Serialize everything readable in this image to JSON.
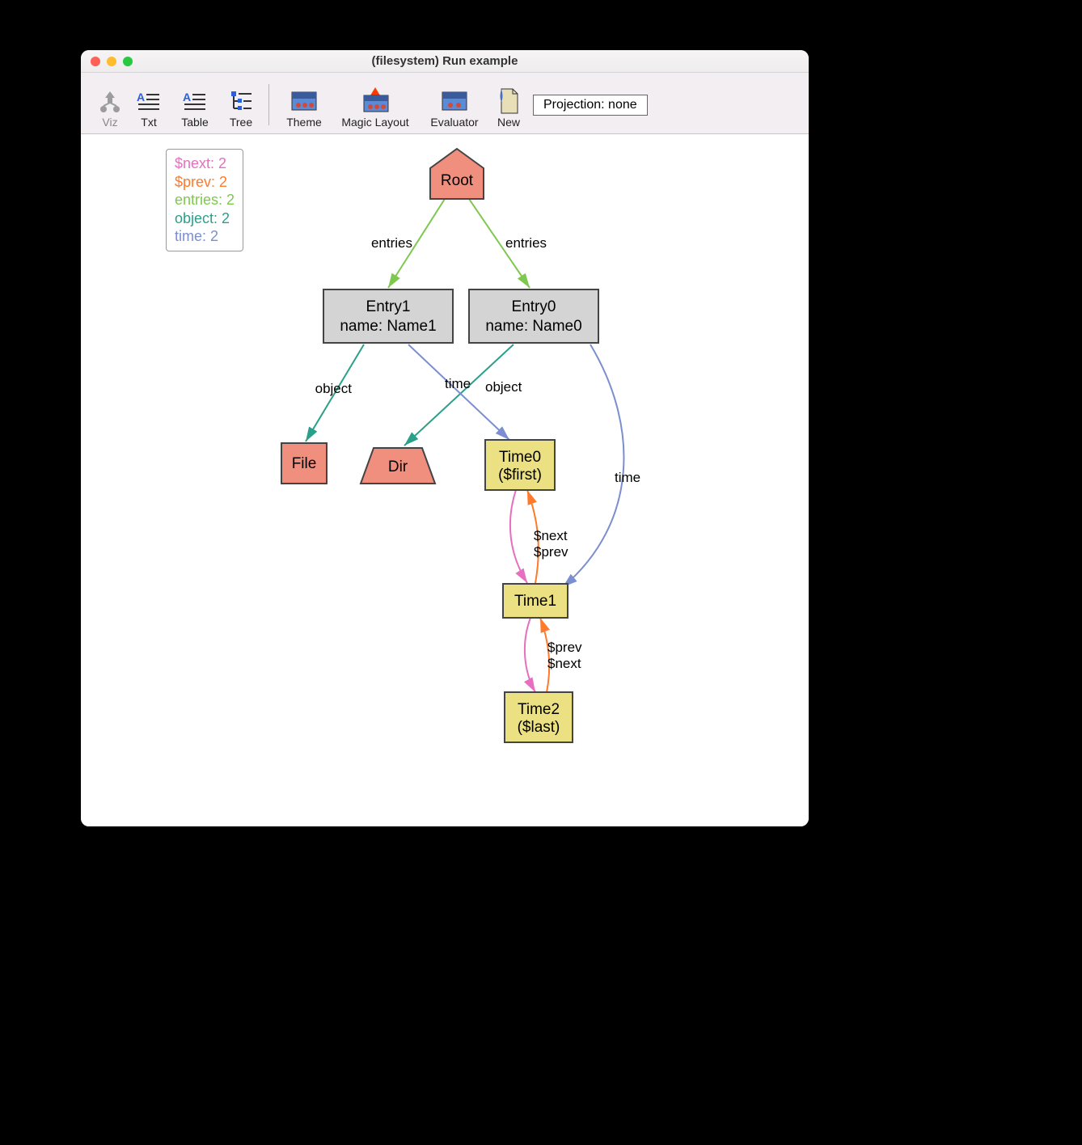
{
  "window": {
    "title": "(filesystem) Run example"
  },
  "toolbar": {
    "viz": "Viz",
    "txt": "Txt",
    "table": "Table",
    "tree": "Tree",
    "theme": "Theme",
    "magic": "Magic Layout",
    "evaluator": "Evaluator",
    "new": "New",
    "projection": "Projection: none"
  },
  "legend": {
    "next": "$next: 2",
    "prev": "$prev: 2",
    "entries": "entries: 2",
    "object": "object: 2",
    "time": "time: 2"
  },
  "nodes": {
    "root": "Root",
    "entry1_l1": "Entry1",
    "entry1_l2": "name: Name1",
    "entry0_l1": "Entry0",
    "entry0_l2": "name: Name0",
    "file": "File",
    "dir": "Dir",
    "time0_l1": "Time0",
    "time0_l2": "($first)",
    "time1": "Time1",
    "time2_l1": "Time2",
    "time2_l2": "($last)"
  },
  "edges": {
    "entries": "entries",
    "object": "object",
    "time": "time",
    "next": "$next",
    "prev": "$prev"
  },
  "colors": {
    "next": "#e66fbf",
    "prev": "#ff7a2a",
    "entries": "#7ec850",
    "object": "#2aa08a",
    "time": "#7b8ecf",
    "node_red": "#f08f7e",
    "node_grey": "#d4d4d4",
    "node_yellow": "#ebe082"
  }
}
